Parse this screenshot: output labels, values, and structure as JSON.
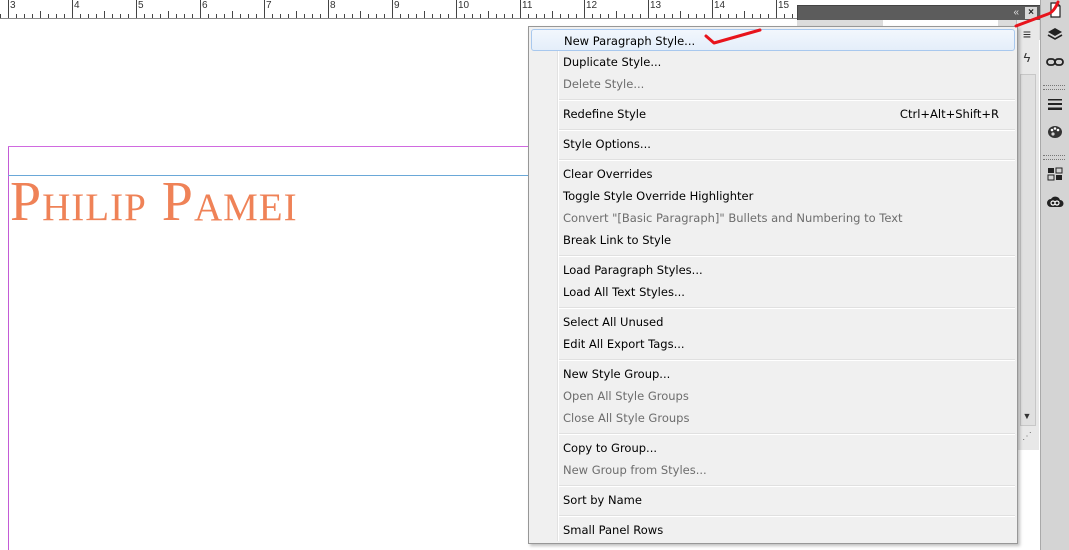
{
  "ruler": {
    "numbers": [
      "3",
      "4",
      "5",
      "6",
      "7",
      "8",
      "9",
      "10",
      "11",
      "12",
      "13",
      "14",
      "15"
    ]
  },
  "document": {
    "title": "Philip Pamei"
  },
  "panel": {
    "collapse_label": "«",
    "close_label": "×",
    "menu_icon": "≡",
    "lightning_icon": "ϟ"
  },
  "menu": {
    "new_paragraph_style": "New Paragraph Style...",
    "duplicate_style": "Duplicate Style...",
    "delete_style": "Delete Style...",
    "redefine_style": "Redefine Style",
    "redefine_shortcut": "Ctrl+Alt+Shift+R",
    "style_options": "Style Options...",
    "clear_overrides": "Clear Overrides",
    "toggle_highlighter": "Toggle Style Override Highlighter",
    "convert_bullets": "Convert \"[Basic Paragraph]\" Bullets and Numbering to Text",
    "break_link": "Break Link to Style",
    "load_paragraph_styles": "Load Paragraph Styles...",
    "load_all_text_styles": "Load All Text Styles...",
    "select_all_unused": "Select All Unused",
    "edit_export_tags": "Edit All Export Tags...",
    "new_style_group": "New Style Group...",
    "open_all_groups": "Open All Style Groups",
    "close_all_groups": "Close All Style Groups",
    "copy_to_group": "Copy to Group...",
    "new_group_from_styles": "New Group from Styles...",
    "sort_by_name": "Sort by Name",
    "small_panel_rows": "Small Panel Rows"
  },
  "colors": {
    "title": "#ef8257",
    "annotation": "#e8141c",
    "menu_bg": "#f0f0f0",
    "hover_border": "#a8c8ee"
  }
}
